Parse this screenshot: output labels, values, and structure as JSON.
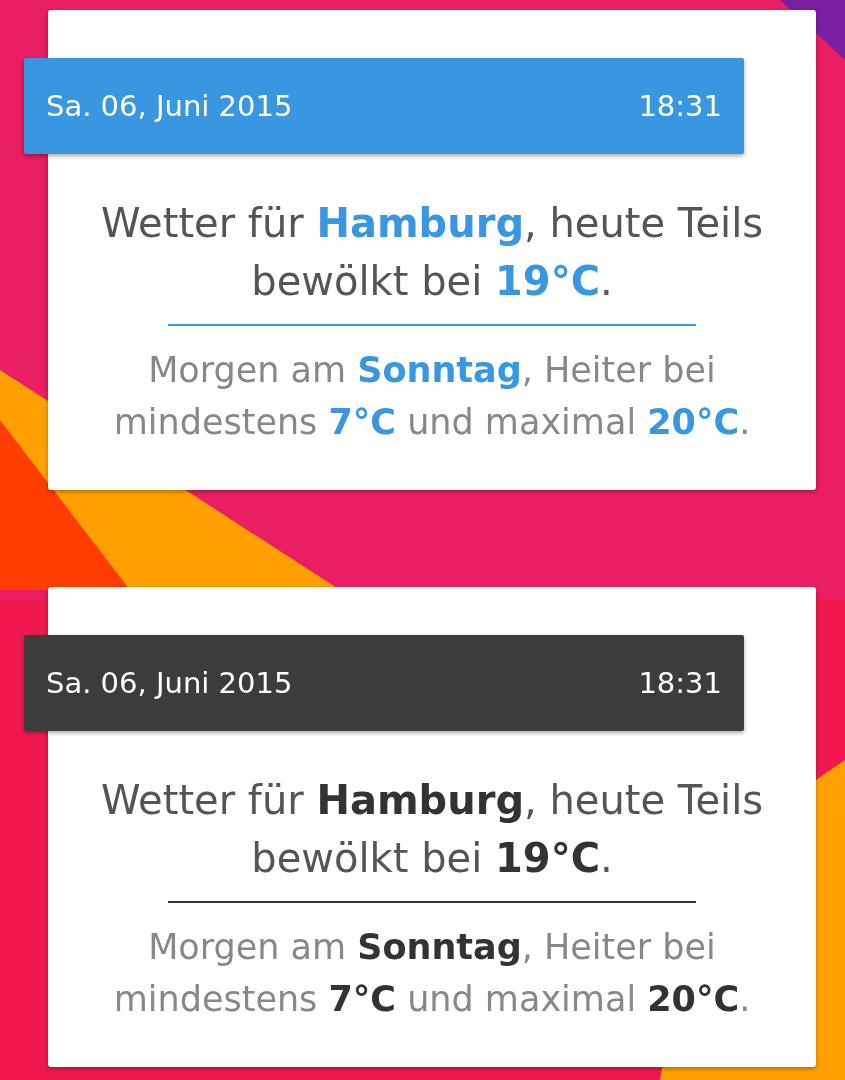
{
  "widgets": [
    {
      "header": {
        "color": "#3897e0"
      },
      "highlight": {
        "color": "#3897e0"
      },
      "date": "Sa. 06, Juni 2015",
      "time": "18:31",
      "headline": "Wetter für **Hamburg**, heute Teils bewölkt bei **19°C**.",
      "forecast": "Morgen am **Sonntag**, Heiter bei mindestens **7°C** und maximal **20°C**."
    },
    {
      "header": {
        "color": "#3c3c3a"
      },
      "highlight": {
        "color": "#333333"
      },
      "date": "Sa. 06, Juni 2015",
      "time": "18:31",
      "headline": "Wetter für **Hamburg**, heute Teils bewölkt bei **19°C**.",
      "forecast": "Morgen am **Sonntag**, Heiter bei mindestens **7°C** und maximal **20°C**."
    }
  ]
}
